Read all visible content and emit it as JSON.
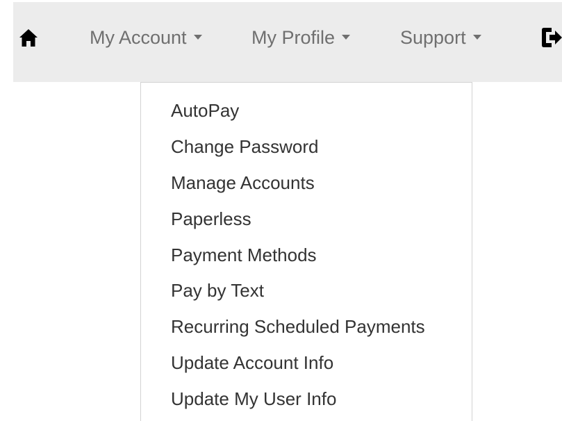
{
  "navbar": {
    "home_icon": "home-icon",
    "logout_icon": "sign-out-icon",
    "items": [
      {
        "label": "My Account",
        "state": "open"
      },
      {
        "label": "My Profile"
      },
      {
        "label": "Support"
      }
    ]
  },
  "dropdown": {
    "items": [
      {
        "label": "AutoPay"
      },
      {
        "label": "Change Password"
      },
      {
        "label": "Manage Accounts"
      },
      {
        "label": "Paperless"
      },
      {
        "label": "Payment Methods"
      },
      {
        "label": "Pay by Text"
      },
      {
        "label": "Recurring Scheduled Payments"
      },
      {
        "label": "Update Account Info"
      },
      {
        "label": "Update My User Info"
      }
    ]
  },
  "colors": {
    "navbar_bg": "#ececec",
    "nav_text": "#6f6f6f",
    "menu_text": "#333333",
    "menu_border": "#d2d2d2"
  }
}
